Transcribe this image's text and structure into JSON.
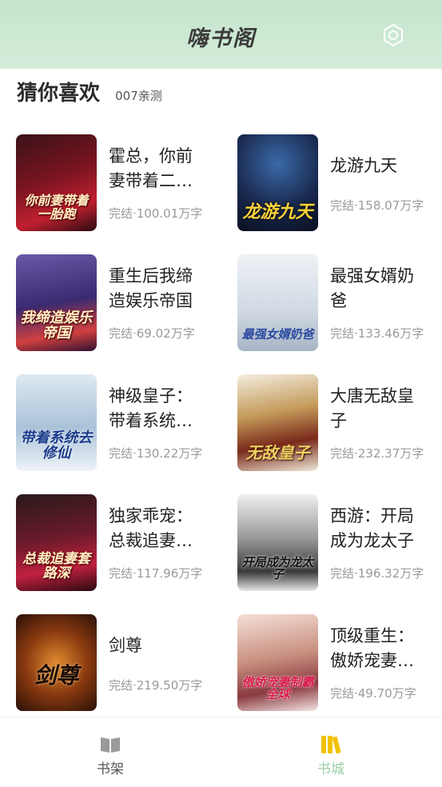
{
  "header": {
    "title": "嗨书阁"
  },
  "section": {
    "title": "猜你喜欢",
    "subtitle": "007亲测"
  },
  "books": [
    {
      "title": "霍总，你前妻带着二…",
      "status": "完结·100.01万字",
      "cover_text": "你前妻带着一胎跑"
    },
    {
      "title": "龙游九天",
      "status": "完结·158.07万字",
      "cover_text": "龙游九天"
    },
    {
      "title": "重生后我缔造娱乐帝国",
      "status": "完结·69.02万字",
      "cover_text": "我缔造娱乐帝国"
    },
    {
      "title": "最强女婿奶爸",
      "status": "完结·133.46万字",
      "cover_text": "最强女婿奶爸"
    },
    {
      "title": "神级皇子：带着系统…",
      "status": "完结·130.22万字",
      "cover_text": "带着系统去修仙"
    },
    {
      "title": "大唐无敌皇子",
      "status": "完结·232.37万字",
      "cover_text": "无敌皇子"
    },
    {
      "title": "独家乖宠：总裁追妻…",
      "status": "完结·117.96万字",
      "cover_text": "总裁追妻套路深"
    },
    {
      "title": "西游：开局成为龙太子",
      "status": "完结·196.32万字",
      "cover_text": "开局成为龙太子"
    },
    {
      "title": "剑尊",
      "status": "完结·219.50万字",
      "cover_text": "剑尊"
    },
    {
      "title": "顶级重生：傲娇宠妻…",
      "status": "完结·49.70万字",
      "cover_text": "傲娇宠妻制霸全球"
    }
  ],
  "tabs": [
    {
      "label": "书架",
      "icon": "book-icon",
      "active": false
    },
    {
      "label": "书城",
      "icon": "library-icon",
      "active": true
    }
  ],
  "colors": {
    "header_bg": "#c4e5cc",
    "tab_active": "#f2c200",
    "tab_active_label": "#9ccfa8",
    "tab_inactive": "#555555"
  }
}
